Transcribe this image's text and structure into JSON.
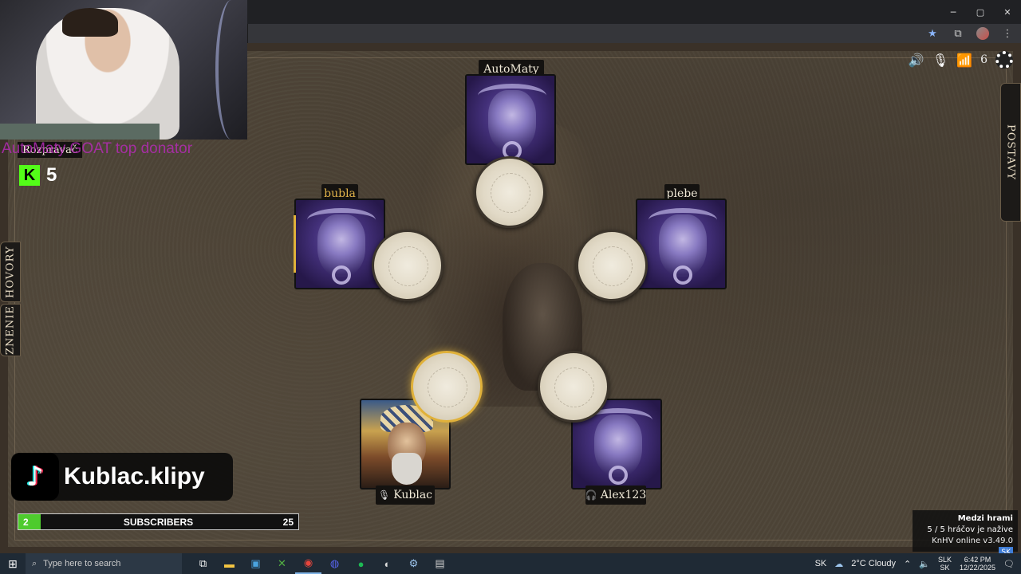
{
  "window_controls": {
    "minimize": "─",
    "maximize": "▢",
    "close": "✕"
  },
  "game": {
    "players": {
      "top": {
        "name": "AutoMaty"
      },
      "left": {
        "name": "bubla"
      },
      "right": {
        "name": "plebe"
      },
      "bottom_left": {
        "name": "Kublac",
        "status_icon": "mic-muted-icon"
      },
      "bottom_right": {
        "name": "Alex123",
        "status_icon": "headphones-icon"
      }
    },
    "hud": {
      "connection_count": "6"
    },
    "side_tabs": {
      "hovory": "HOVORY",
      "znenie": "ZNENIE",
      "postavy": "POSTAVY"
    },
    "narrator_label": "Rozprávač",
    "info": {
      "phase": "Medzi hrami",
      "alive": "5 / 5 hráčov je nažive",
      "version": "KnHV online v3.49.0",
      "lang": "SK"
    }
  },
  "overlay": {
    "donator_text": "AutoMaty GOAT top donator",
    "kick_count": "5",
    "tiktok_handle": "Kublac.klipy",
    "subscribers": {
      "current": "2",
      "label": "SUBSCRIBERS",
      "goal": "25",
      "progress": 0.08
    }
  },
  "taskbar": {
    "search_placeholder": "Type here to search",
    "weather": "2°C  Cloudy",
    "lang": "SK",
    "kbd_lang_top": "SLK",
    "kbd_lang_bottom": "SK",
    "time": "6:42 PM",
    "date": "12/22/2025"
  },
  "colors": {
    "accent_gold": "#e0b13a",
    "kick_green": "#53fc18",
    "sub_green": "#4ecb2d",
    "card_purple": "#43307a"
  }
}
